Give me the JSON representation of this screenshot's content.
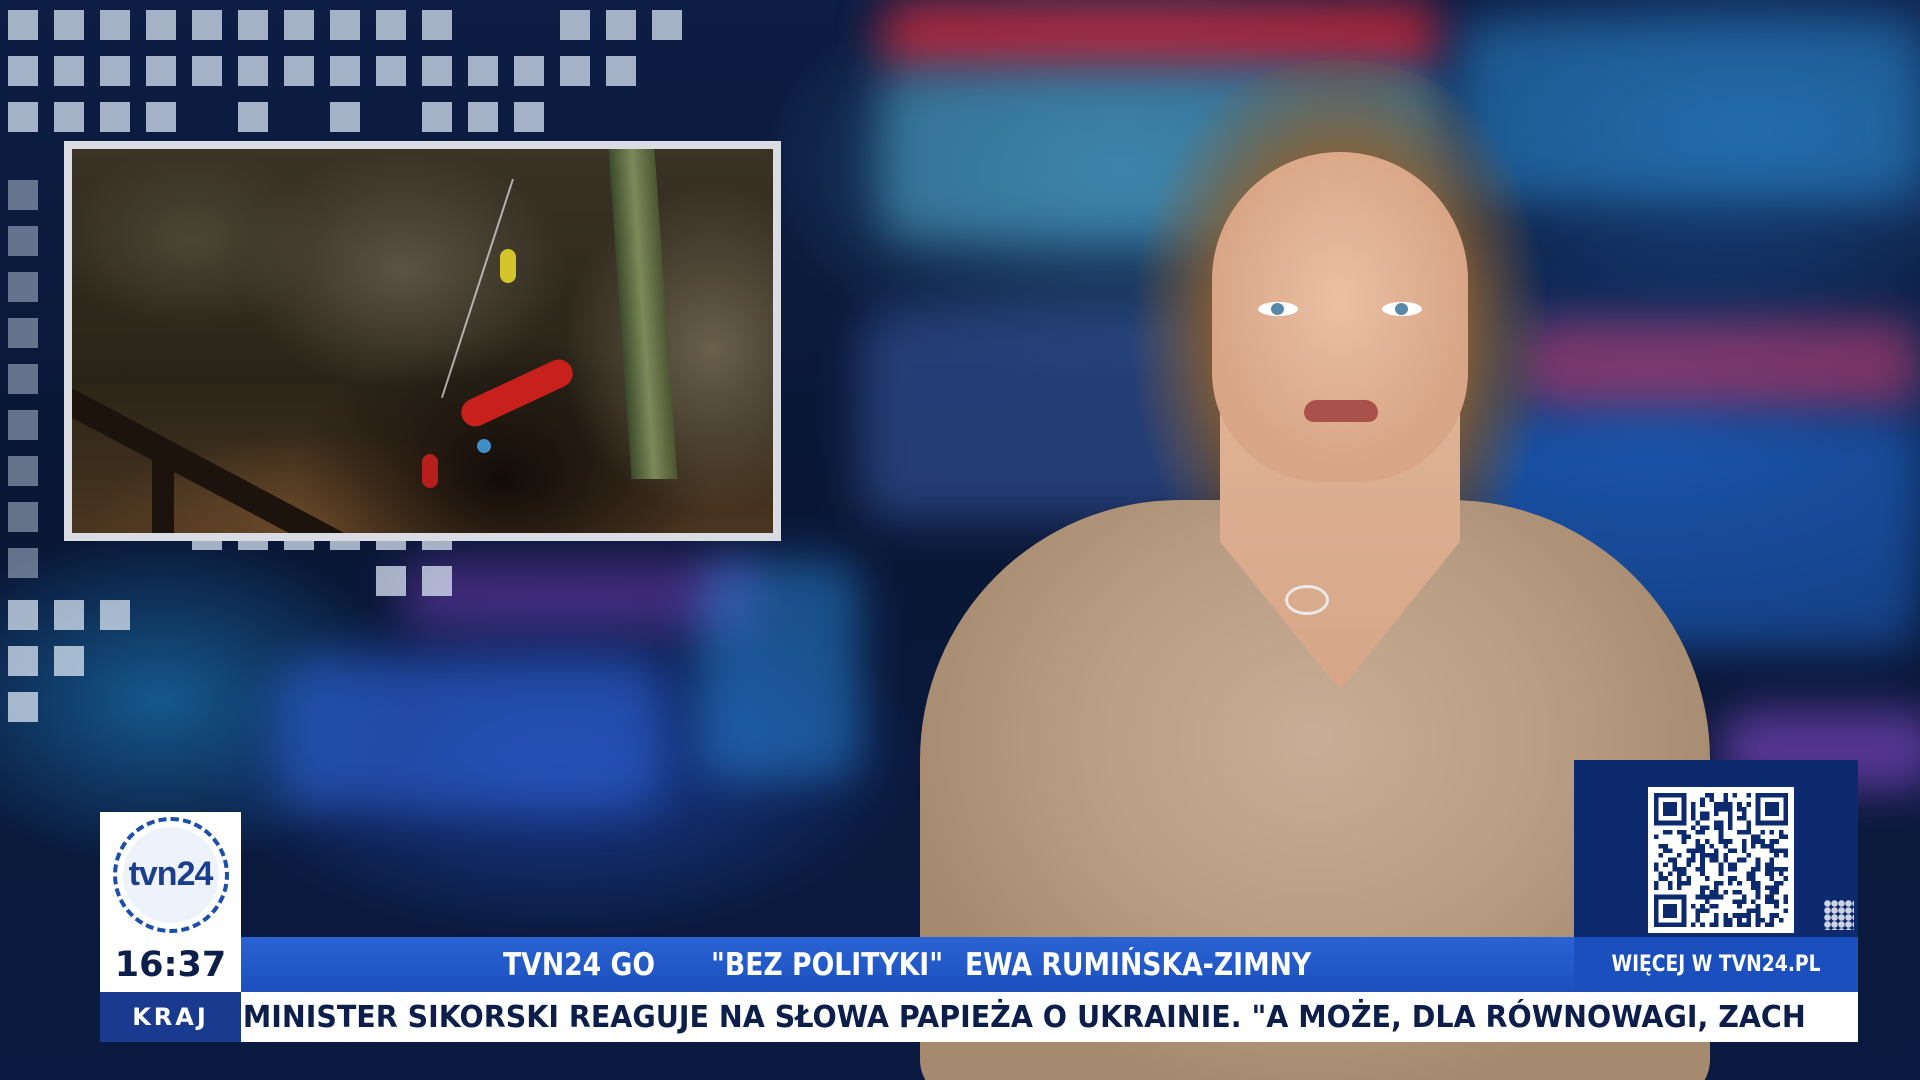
{
  "channel": {
    "logo_text": "tvn24",
    "time": "16:37",
    "section": "KRAJ",
    "colors": {
      "brand_blue": "#1c4fbe",
      "dark_blue": "#1a3a8f",
      "panel_navy": "#0e2a6e"
    }
  },
  "topbar": {
    "program": "TVN24 GO",
    "show": "\"BEZ POLITYKI\"",
    "guest": "EWA RUMIŃSKA-ZIMNY"
  },
  "ticker": {
    "text": "MINISTER SIKORSKI REAGUJE NA SŁOWA PAPIEŻA O UKRAINIE. \"A MOŻE, DLA RÓWNOWAGI, ZACH"
  },
  "promo": {
    "qr_icon": "qr-code-icon",
    "link_label": "WIĘCEJ W TVN24.PL"
  }
}
